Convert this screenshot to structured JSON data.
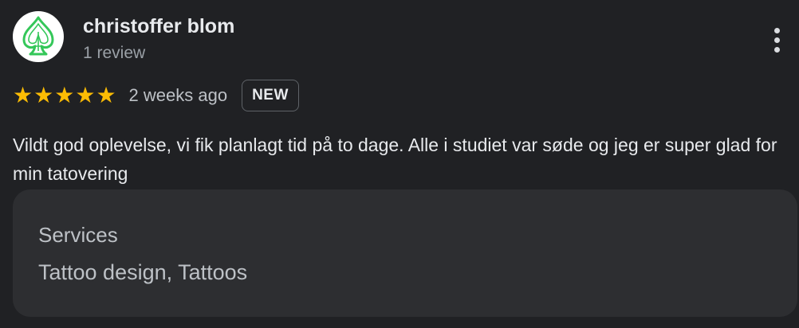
{
  "review": {
    "reviewer_name": "christoffer blom",
    "reviewer_meta": "1 review",
    "avatar_icon": "green-spade-logo",
    "more_icon": "more-vertical-icon",
    "rating": 5,
    "rating_max": 5,
    "star_color": "#fbbc04",
    "date": "2 weeks ago",
    "badge": "NEW",
    "text": "Vildt god oplevelse, vi fik planlagt tid på to dage. Alle i studiet var søde og jeg er super glad for min tatovering"
  },
  "services": {
    "title": "Services",
    "value": "Tattoo design, Tattoos"
  },
  "colors": {
    "background": "#202124",
    "card": "#2d2e31",
    "logo_green": "#34c759"
  }
}
